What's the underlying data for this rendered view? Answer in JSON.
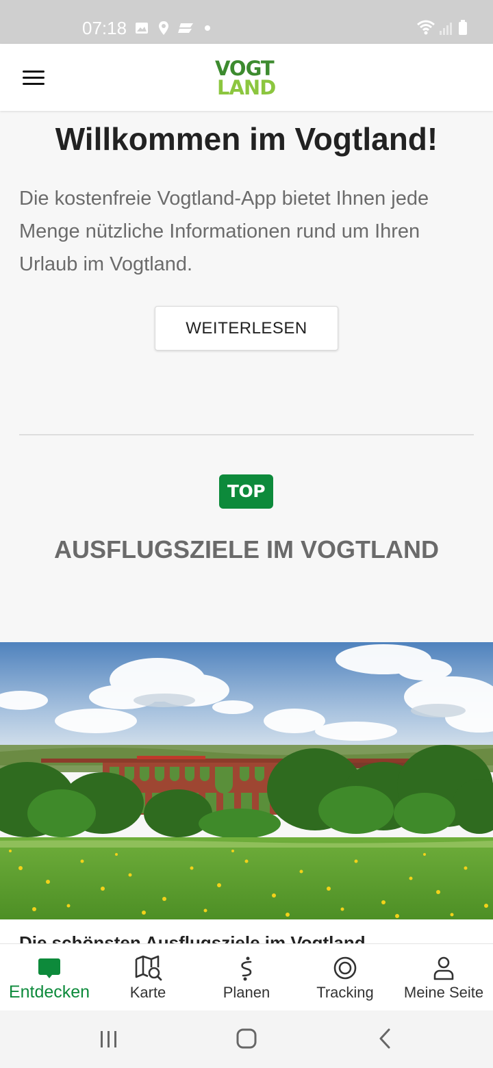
{
  "status_bar": {
    "time": "07:18",
    "icons": [
      "image-icon",
      "location-icon",
      "app-icon",
      "dot-icon",
      "wifi-icon",
      "signal-icon",
      "battery-icon"
    ]
  },
  "header": {
    "menu_icon": "hamburger-menu-icon",
    "logo_line1": "VOGT",
    "logo_line2": "LAND",
    "logo_colors": {
      "top": "#3d8b2f",
      "bottom": "#8cc63f"
    }
  },
  "welcome": {
    "title": "Willkommen im Vogtland!",
    "text": "Die kostenfreie Vogtland-App bietet Ihnen jede Menge nützliche Informationen rund um Ihren Urlaub im Vogtland.",
    "button_label": "WEITERLESEN"
  },
  "section": {
    "badge": "TOP",
    "badge_color": "#0d8a3b",
    "title": "AUSFLUGSZIELE IM VOGTLAND"
  },
  "card": {
    "image": "viaduct-landscape-image",
    "title": "Die schönsten Ausflugsziele im Vogtland"
  },
  "bottom_nav": {
    "active_color": "#0d8a3b",
    "items": [
      {
        "label": "Entdecken",
        "icon": "chat-bubble-icon",
        "active": true
      },
      {
        "label": "Karte",
        "icon": "map-search-icon",
        "active": false
      },
      {
        "label": "Planen",
        "icon": "route-icon",
        "active": false
      },
      {
        "label": "Tracking",
        "icon": "target-icon",
        "active": false
      },
      {
        "label": "Meine Seite",
        "icon": "user-icon",
        "active": false
      }
    ]
  },
  "system_nav": {
    "icons": [
      "recents-icon",
      "home-icon",
      "back-icon"
    ]
  }
}
